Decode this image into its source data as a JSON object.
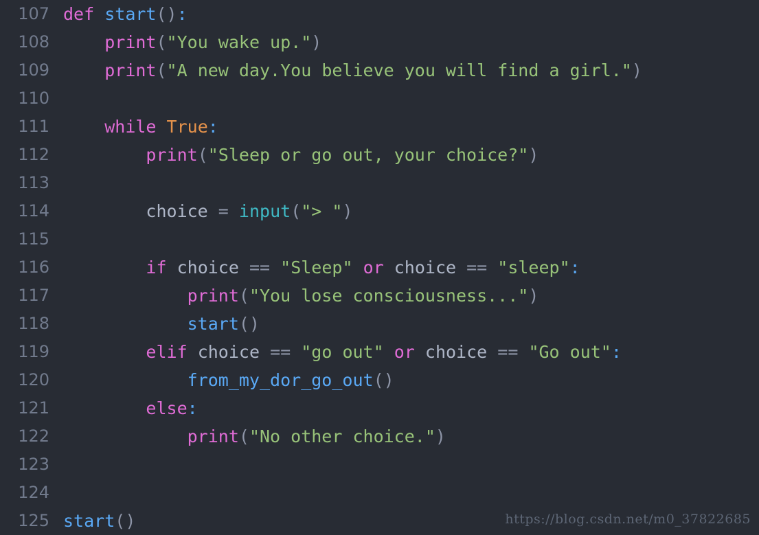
{
  "editor": {
    "theme_background": "#282c34",
    "gutter_color": "#717a8c",
    "font_size_px": 25,
    "line_height_px": 41,
    "language": "python",
    "first_line_number": 107,
    "last_line_number": 125
  },
  "colors": {
    "keyword": "#e06cd6",
    "boolean": "#e5924b",
    "function": "#5aa9f5",
    "builtin": "#3fb9c4",
    "string": "#98c379",
    "plain": "#aeb6c7",
    "punct": "#8d94a6",
    "operator": "#8d94a6",
    "colon": "#5aa9f5"
  },
  "watermark": {
    "text": "https://blog.csdn.net/m0_37822685"
  },
  "lines": [
    {
      "number": "107",
      "text": "def start():",
      "tokens": [
        {
          "t": "def",
          "c": "keyword"
        },
        {
          "t": " ",
          "c": "plain"
        },
        {
          "t": "start",
          "c": "function"
        },
        {
          "t": "()",
          "c": "punct"
        },
        {
          "t": ":",
          "c": "colon"
        }
      ]
    },
    {
      "number": "108",
      "text": "    print(\"You wake up.\")",
      "tokens": [
        {
          "t": "    ",
          "c": "plain"
        },
        {
          "t": "print",
          "c": "keyword"
        },
        {
          "t": "(",
          "c": "punct"
        },
        {
          "t": "\"You wake up.\"",
          "c": "string"
        },
        {
          "t": ")",
          "c": "punct"
        }
      ]
    },
    {
      "number": "109",
      "text": "    print(\"A new day.You believe you will find a girl.\")",
      "tokens": [
        {
          "t": "    ",
          "c": "plain"
        },
        {
          "t": "print",
          "c": "keyword"
        },
        {
          "t": "(",
          "c": "punct"
        },
        {
          "t": "\"A new day.You believe you will find a girl.\"",
          "c": "string"
        },
        {
          "t": ")",
          "c": "punct"
        }
      ]
    },
    {
      "number": "110",
      "text": "",
      "tokens": []
    },
    {
      "number": "111",
      "text": "    while True:",
      "tokens": [
        {
          "t": "    ",
          "c": "plain"
        },
        {
          "t": "while",
          "c": "keyword"
        },
        {
          "t": " ",
          "c": "plain"
        },
        {
          "t": "True",
          "c": "boolean"
        },
        {
          "t": ":",
          "c": "colon"
        }
      ]
    },
    {
      "number": "112",
      "text": "        print(\"Sleep or go out, your choice?\")",
      "tokens": [
        {
          "t": "        ",
          "c": "plain"
        },
        {
          "t": "print",
          "c": "keyword"
        },
        {
          "t": "(",
          "c": "punct"
        },
        {
          "t": "\"Sleep or go out, your choice?\"",
          "c": "string"
        },
        {
          "t": ")",
          "c": "punct"
        }
      ]
    },
    {
      "number": "113",
      "text": "",
      "tokens": []
    },
    {
      "number": "114",
      "text": "        choice = input(\"> \")",
      "tokens": [
        {
          "t": "        ",
          "c": "plain"
        },
        {
          "t": "choice",
          "c": "plain"
        },
        {
          "t": " ",
          "c": "plain"
        },
        {
          "t": "=",
          "c": "operator"
        },
        {
          "t": " ",
          "c": "plain"
        },
        {
          "t": "input",
          "c": "builtin"
        },
        {
          "t": "(",
          "c": "punct"
        },
        {
          "t": "\"> \"",
          "c": "string"
        },
        {
          "t": ")",
          "c": "punct"
        }
      ]
    },
    {
      "number": "115",
      "text": "",
      "tokens": []
    },
    {
      "number": "116",
      "text": "        if choice == \"Sleep\" or choice == \"sleep\":",
      "tokens": [
        {
          "t": "        ",
          "c": "plain"
        },
        {
          "t": "if",
          "c": "keyword"
        },
        {
          "t": " ",
          "c": "plain"
        },
        {
          "t": "choice",
          "c": "plain"
        },
        {
          "t": " ",
          "c": "plain"
        },
        {
          "t": "==",
          "c": "operator"
        },
        {
          "t": " ",
          "c": "plain"
        },
        {
          "t": "\"Sleep\"",
          "c": "string"
        },
        {
          "t": " ",
          "c": "plain"
        },
        {
          "t": "or",
          "c": "keyword"
        },
        {
          "t": " ",
          "c": "plain"
        },
        {
          "t": "choice",
          "c": "plain"
        },
        {
          "t": " ",
          "c": "plain"
        },
        {
          "t": "==",
          "c": "operator"
        },
        {
          "t": " ",
          "c": "plain"
        },
        {
          "t": "\"sleep\"",
          "c": "string"
        },
        {
          "t": ":",
          "c": "colon"
        }
      ]
    },
    {
      "number": "117",
      "text": "            print(\"You lose consciousness...\")",
      "tokens": [
        {
          "t": "            ",
          "c": "plain"
        },
        {
          "t": "print",
          "c": "keyword"
        },
        {
          "t": "(",
          "c": "punct"
        },
        {
          "t": "\"You lose consciousness...\"",
          "c": "string"
        },
        {
          "t": ")",
          "c": "punct"
        }
      ]
    },
    {
      "number": "118",
      "text": "            start()",
      "tokens": [
        {
          "t": "            ",
          "c": "plain"
        },
        {
          "t": "start",
          "c": "function"
        },
        {
          "t": "()",
          "c": "punct"
        }
      ]
    },
    {
      "number": "119",
      "text": "        elif choice == \"go out\" or choice == \"Go out\":",
      "tokens": [
        {
          "t": "        ",
          "c": "plain"
        },
        {
          "t": "elif",
          "c": "keyword"
        },
        {
          "t": " ",
          "c": "plain"
        },
        {
          "t": "choice",
          "c": "plain"
        },
        {
          "t": " ",
          "c": "plain"
        },
        {
          "t": "==",
          "c": "operator"
        },
        {
          "t": " ",
          "c": "plain"
        },
        {
          "t": "\"go out\"",
          "c": "string"
        },
        {
          "t": " ",
          "c": "plain"
        },
        {
          "t": "or",
          "c": "keyword"
        },
        {
          "t": " ",
          "c": "plain"
        },
        {
          "t": "choice",
          "c": "plain"
        },
        {
          "t": " ",
          "c": "plain"
        },
        {
          "t": "==",
          "c": "operator"
        },
        {
          "t": " ",
          "c": "plain"
        },
        {
          "t": "\"Go out\"",
          "c": "string"
        },
        {
          "t": ":",
          "c": "colon"
        }
      ]
    },
    {
      "number": "120",
      "text": "            from_my_dor_go_out()",
      "tokens": [
        {
          "t": "            ",
          "c": "plain"
        },
        {
          "t": "from_my_dor_go_out",
          "c": "function"
        },
        {
          "t": "()",
          "c": "punct"
        }
      ]
    },
    {
      "number": "121",
      "text": "        else:",
      "tokens": [
        {
          "t": "        ",
          "c": "plain"
        },
        {
          "t": "else",
          "c": "keyword"
        },
        {
          "t": ":",
          "c": "colon"
        }
      ]
    },
    {
      "number": "122",
      "text": "            print(\"No other choice.\")",
      "tokens": [
        {
          "t": "            ",
          "c": "plain"
        },
        {
          "t": "print",
          "c": "keyword"
        },
        {
          "t": "(",
          "c": "punct"
        },
        {
          "t": "\"No other choice.\"",
          "c": "string"
        },
        {
          "t": ")",
          "c": "punct"
        }
      ]
    },
    {
      "number": "123",
      "text": "",
      "tokens": []
    },
    {
      "number": "124",
      "text": "",
      "tokens": []
    },
    {
      "number": "125",
      "text": "start()",
      "tokens": [
        {
          "t": "start",
          "c": "function"
        },
        {
          "t": "()",
          "c": "punct"
        }
      ]
    }
  ]
}
